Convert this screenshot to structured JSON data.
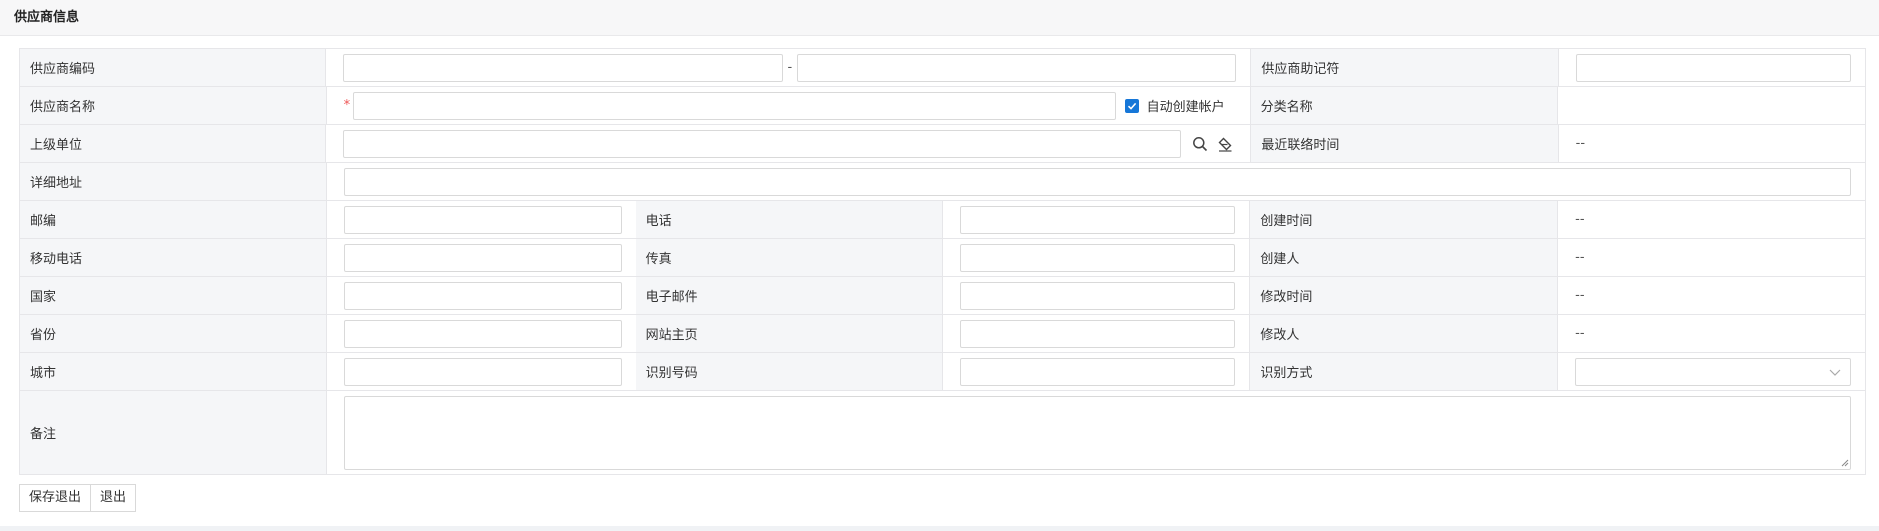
{
  "panel": {
    "title": "供应商信息"
  },
  "form": {
    "supplier_code": {
      "label": "供应商编码",
      "from_value": "",
      "to_value": "",
      "separator": "-"
    },
    "mnemonic": {
      "label": "供应商助记符",
      "value": ""
    },
    "supplier_name": {
      "label": "供应商名称",
      "value": "",
      "required_mark": "*"
    },
    "auto_create_account": {
      "label": "自动创建帐户",
      "checked": true
    },
    "category_name": {
      "label": "分类名称",
      "value": ""
    },
    "parent_unit": {
      "label": "上级单位",
      "value": ""
    },
    "last_contact_time": {
      "label": "最近联络时间",
      "value": "--"
    },
    "address": {
      "label": "详细地址",
      "value": ""
    },
    "postcode": {
      "label": "邮编",
      "value": ""
    },
    "phone": {
      "label": "电话",
      "value": ""
    },
    "created_time": {
      "label": "创建时间",
      "value": "--"
    },
    "mobile": {
      "label": "移动电话",
      "value": ""
    },
    "fax": {
      "label": "传真",
      "value": ""
    },
    "creator": {
      "label": "创建人",
      "value": "--"
    },
    "country": {
      "label": "国家",
      "value": ""
    },
    "email": {
      "label": "电子邮件",
      "value": ""
    },
    "modified_time": {
      "label": "修改时间",
      "value": "--"
    },
    "province": {
      "label": "省份",
      "value": ""
    },
    "website": {
      "label": "网站主页",
      "value": ""
    },
    "modifier": {
      "label": "修改人",
      "value": "--"
    },
    "city": {
      "label": "城市",
      "value": ""
    },
    "id_number": {
      "label": "识别号码",
      "value": ""
    },
    "id_method": {
      "label": "识别方式",
      "value": ""
    },
    "remark": {
      "label": "备注",
      "value": ""
    }
  },
  "buttons": {
    "save_exit": "保存退出",
    "exit": "退出"
  },
  "colors": {
    "accent": "#1677d8",
    "required": "#ee5555",
    "label_bg": "#f5f6f8",
    "border": "#e6e6e9"
  },
  "icons": {
    "search": "search-icon",
    "clear": "eraser-icon",
    "select": "chevron-down-icon",
    "check": "check-icon"
  }
}
